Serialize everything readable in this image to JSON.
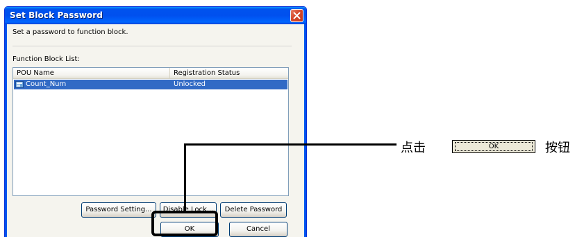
{
  "dialog": {
    "title": "Set Block Password",
    "prompt": "Set a password to function block.",
    "list_label": "Function Block List:",
    "columns": [
      "POU Name",
      "Registration Status"
    ],
    "rows": [
      {
        "pou_name": "Count_Num",
        "status": "Unlocked",
        "selected": true
      }
    ],
    "buttons": {
      "password_setting": "Password Setting...",
      "disable_lock": "Disable Lock...",
      "delete_password": "Delete Password",
      "ok": "OK",
      "cancel": "Cancel"
    }
  },
  "callout": {
    "prefix": "点击",
    "button_label": "OK",
    "suffix": "按钮"
  },
  "colors": {
    "titlebar": "#0053ee",
    "selection": "#316ac5",
    "close": "#d5462a"
  }
}
